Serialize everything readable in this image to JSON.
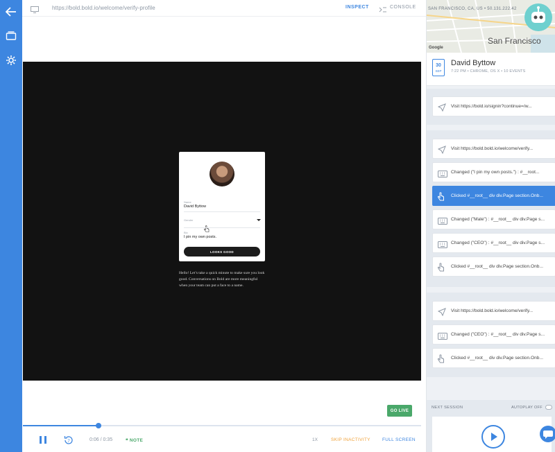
{
  "topbar": {
    "url": "https://bold.bold.io/welcome/verify-profile",
    "inspect": "INSPECT",
    "console": "CONSOLE"
  },
  "player": {
    "card": {
      "name_label": "Name",
      "name_value": "David Byttow",
      "gender_label": "Gender",
      "bio_label": "Bio",
      "bio_value": "I pin my own posts.",
      "button": "LOOKS GOOD"
    },
    "message": "Hello! Let’s take a quick minute to make sure you look good. Conversations on Bold are more meaningful when your team can put a face to a name."
  },
  "go_live": "GO LIVE",
  "controls": {
    "progress": 0.19,
    "time": "0:06 / 0:35",
    "replay_seconds": "7",
    "note": "NOTE",
    "speed": "1X",
    "skip": "SKIP INACTIVITY",
    "fullscreen": "FULL SCREEN"
  },
  "session": {
    "location": "SAN FRANCISCO, CA, US • 50.131.222.42",
    "map_city": "San Francisco",
    "map_credit": "Google",
    "date_day": "30",
    "date_month": "SEP",
    "user": "David Byttow",
    "meta": "7:22 PM • CHROME, OS X • 10 EVENTS"
  },
  "events": [
    {
      "icon": "navigation-arrow-icon",
      "text": "Visit https://bold.io/signin?continue=/w..."
    },
    {
      "icon": "navigation-arrow-icon",
      "text": "Visit https://bold.bold.io/welcome/verify..."
    },
    {
      "icon": "keyboard-icon",
      "text": "Changed (\"I pin my own posts.\") : #__root..."
    },
    {
      "icon": "hand-pointer-icon",
      "text": "Clicked #__root__ div div.Page section.Onb..."
    },
    {
      "icon": "keyboard-icon",
      "text": "Changed (\"Male\") : #__root__ div div.Page s..."
    },
    {
      "icon": "keyboard-icon",
      "text": "Changed (\"CEO\") : #__root__ div div.Page s..."
    },
    {
      "icon": "hand-pointer-icon",
      "text": "Clicked #__root__ div div.Page section.Onb..."
    },
    {
      "icon": "navigation-arrow-icon",
      "text": "Visit https://bold.bold.io/welcome/verify..."
    },
    {
      "icon": "keyboard-icon",
      "text": "Changed (\"CEO\") : #__root__ div div.Page s..."
    },
    {
      "icon": "hand-pointer-icon",
      "text": "Clicked #__root__ div div.Page section.Onb..."
    }
  ],
  "next_session": {
    "label": "NEXT SESSION",
    "autoplay": "AUTOPLAY OFF"
  },
  "colors": {
    "accent": "#3d86e0",
    "live": "#4aa86a",
    "skip": "#f0a23a"
  }
}
